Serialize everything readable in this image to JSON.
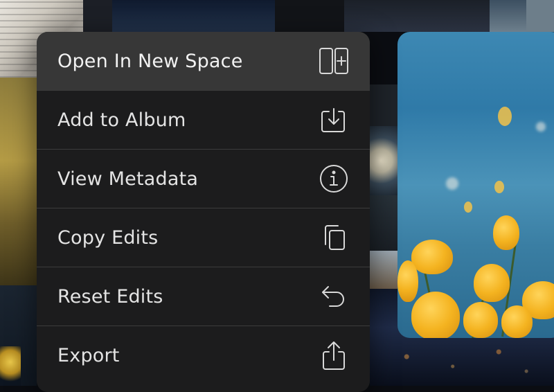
{
  "menu": {
    "items": [
      {
        "label": "Open In New Space",
        "icon": "open-in-new-space-icon"
      },
      {
        "label": "Add to Album",
        "icon": "add-to-album-icon"
      },
      {
        "label": "View Metadata",
        "icon": "info-icon"
      },
      {
        "label": "Copy Edits",
        "icon": "copy-icon"
      },
      {
        "label": "Reset Edits",
        "icon": "undo-arrow-icon"
      },
      {
        "label": "Export",
        "icon": "share-export-icon"
      }
    ]
  },
  "colors": {
    "menu_background": "#1e1e1e",
    "highlight_row": "#383838",
    "separator": "#3c3c3c",
    "text": "#e4e4e4"
  }
}
